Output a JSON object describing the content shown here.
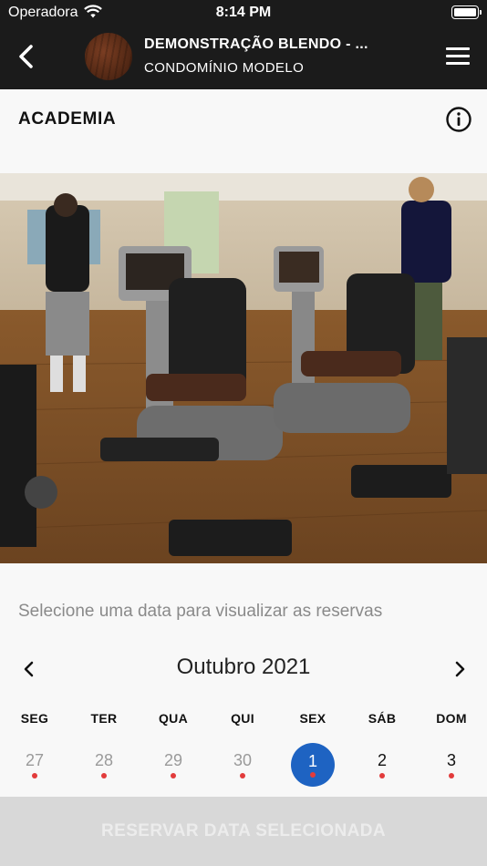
{
  "status_bar": {
    "carrier": "Operadora",
    "time": "8:14 PM"
  },
  "nav": {
    "title": "DEMONSTRAÇÃO BLENDO - ...",
    "subtitle": "CONDOMÍNIO MODELO"
  },
  "page": {
    "title": "ACADEMIA"
  },
  "calendar": {
    "hint": "Selecione uma data para visualizar as reservas",
    "month_label": "Outubro 2021",
    "weekdays": [
      "SEG",
      "TER",
      "QUA",
      "QUI",
      "SEX",
      "SÁB",
      "DOM"
    ],
    "days": [
      {
        "label": "27",
        "state": "previous-month",
        "has_reservation": true
      },
      {
        "label": "28",
        "state": "previous-month",
        "has_reservation": true
      },
      {
        "label": "29",
        "state": "previous-month",
        "has_reservation": true
      },
      {
        "label": "30",
        "state": "previous-month",
        "has_reservation": true
      },
      {
        "label": "1",
        "state": "selected",
        "has_reservation": true
      },
      {
        "label": "2",
        "state": "current-month",
        "has_reservation": true
      },
      {
        "label": "3",
        "state": "current-month",
        "has_reservation": true
      }
    ]
  },
  "actions": {
    "reserve_label": "RESERVAR DATA SELECIONADA"
  },
  "colors": {
    "nav_bg": "#1b1b1b",
    "selected_day": "#1e63c2",
    "reservation_dot": "#e23b3b",
    "button_disabled": "#d8d8d8"
  }
}
